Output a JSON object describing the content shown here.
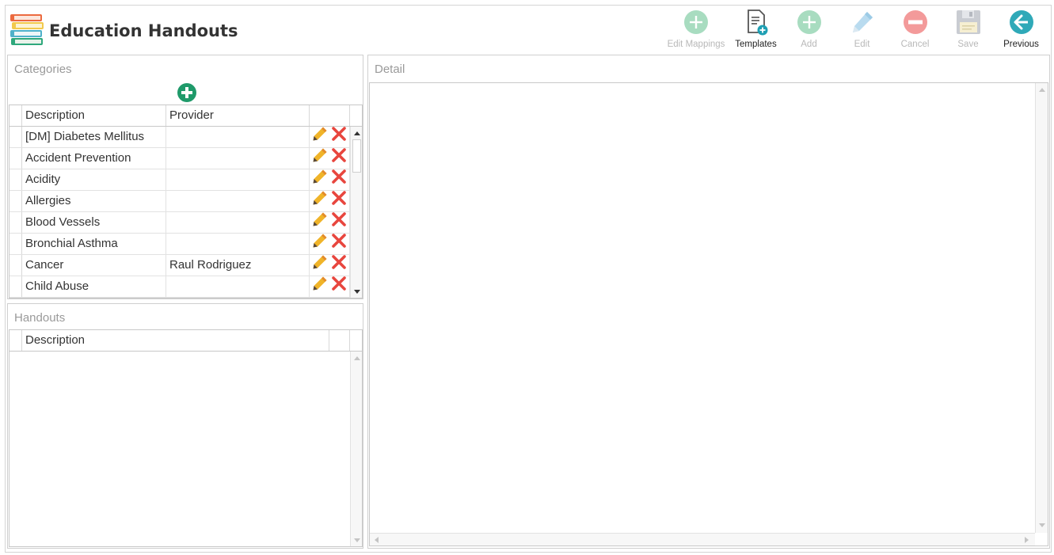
{
  "app": {
    "title": "Education Handouts",
    "logo_icon": "books-icon"
  },
  "toolbar": [
    {
      "id": "edit-mappings",
      "label": "Edit Mappings",
      "icon": "plus-circle-icon",
      "enabled": false
    },
    {
      "id": "templates",
      "label": "Templates",
      "icon": "document-add-icon",
      "enabled": true
    },
    {
      "id": "add",
      "label": "Add",
      "icon": "plus-circle-icon",
      "enabled": false
    },
    {
      "id": "edit",
      "label": "Edit",
      "icon": "pencil-icon",
      "enabled": false
    },
    {
      "id": "cancel",
      "label": "Cancel",
      "icon": "minus-circle-icon",
      "enabled": false
    },
    {
      "id": "save",
      "label": "Save",
      "icon": "floppy-disk-icon",
      "enabled": false
    },
    {
      "id": "previous",
      "label": "Previous",
      "icon": "arrow-left-circle-icon",
      "enabled": true
    }
  ],
  "categories": {
    "title": "Categories",
    "columns": {
      "description": "Description",
      "provider": "Provider"
    },
    "rows": [
      {
        "description": "[DM] Diabetes Mellitus",
        "provider": ""
      },
      {
        "description": "Accident Prevention",
        "provider": ""
      },
      {
        "description": "Acidity",
        "provider": ""
      },
      {
        "description": "Allergies",
        "provider": ""
      },
      {
        "description": "Blood Vessels",
        "provider": ""
      },
      {
        "description": "Bronchial Asthma",
        "provider": ""
      },
      {
        "description": "Cancer",
        "provider": "Raul Rodriguez"
      },
      {
        "description": "Child Abuse",
        "provider": ""
      }
    ]
  },
  "handouts": {
    "title": "Handouts",
    "columns": {
      "description": "Description"
    }
  },
  "detail": {
    "title": "Detail"
  },
  "colors": {
    "accent_green": "#1f9a6a",
    "disabled_green": "#a8dcc0",
    "cancel_red": "#f39a9a",
    "pencil_yellow": "#f0b429",
    "delete_red": "#e8463e",
    "previous_teal": "#2fa9b8"
  }
}
